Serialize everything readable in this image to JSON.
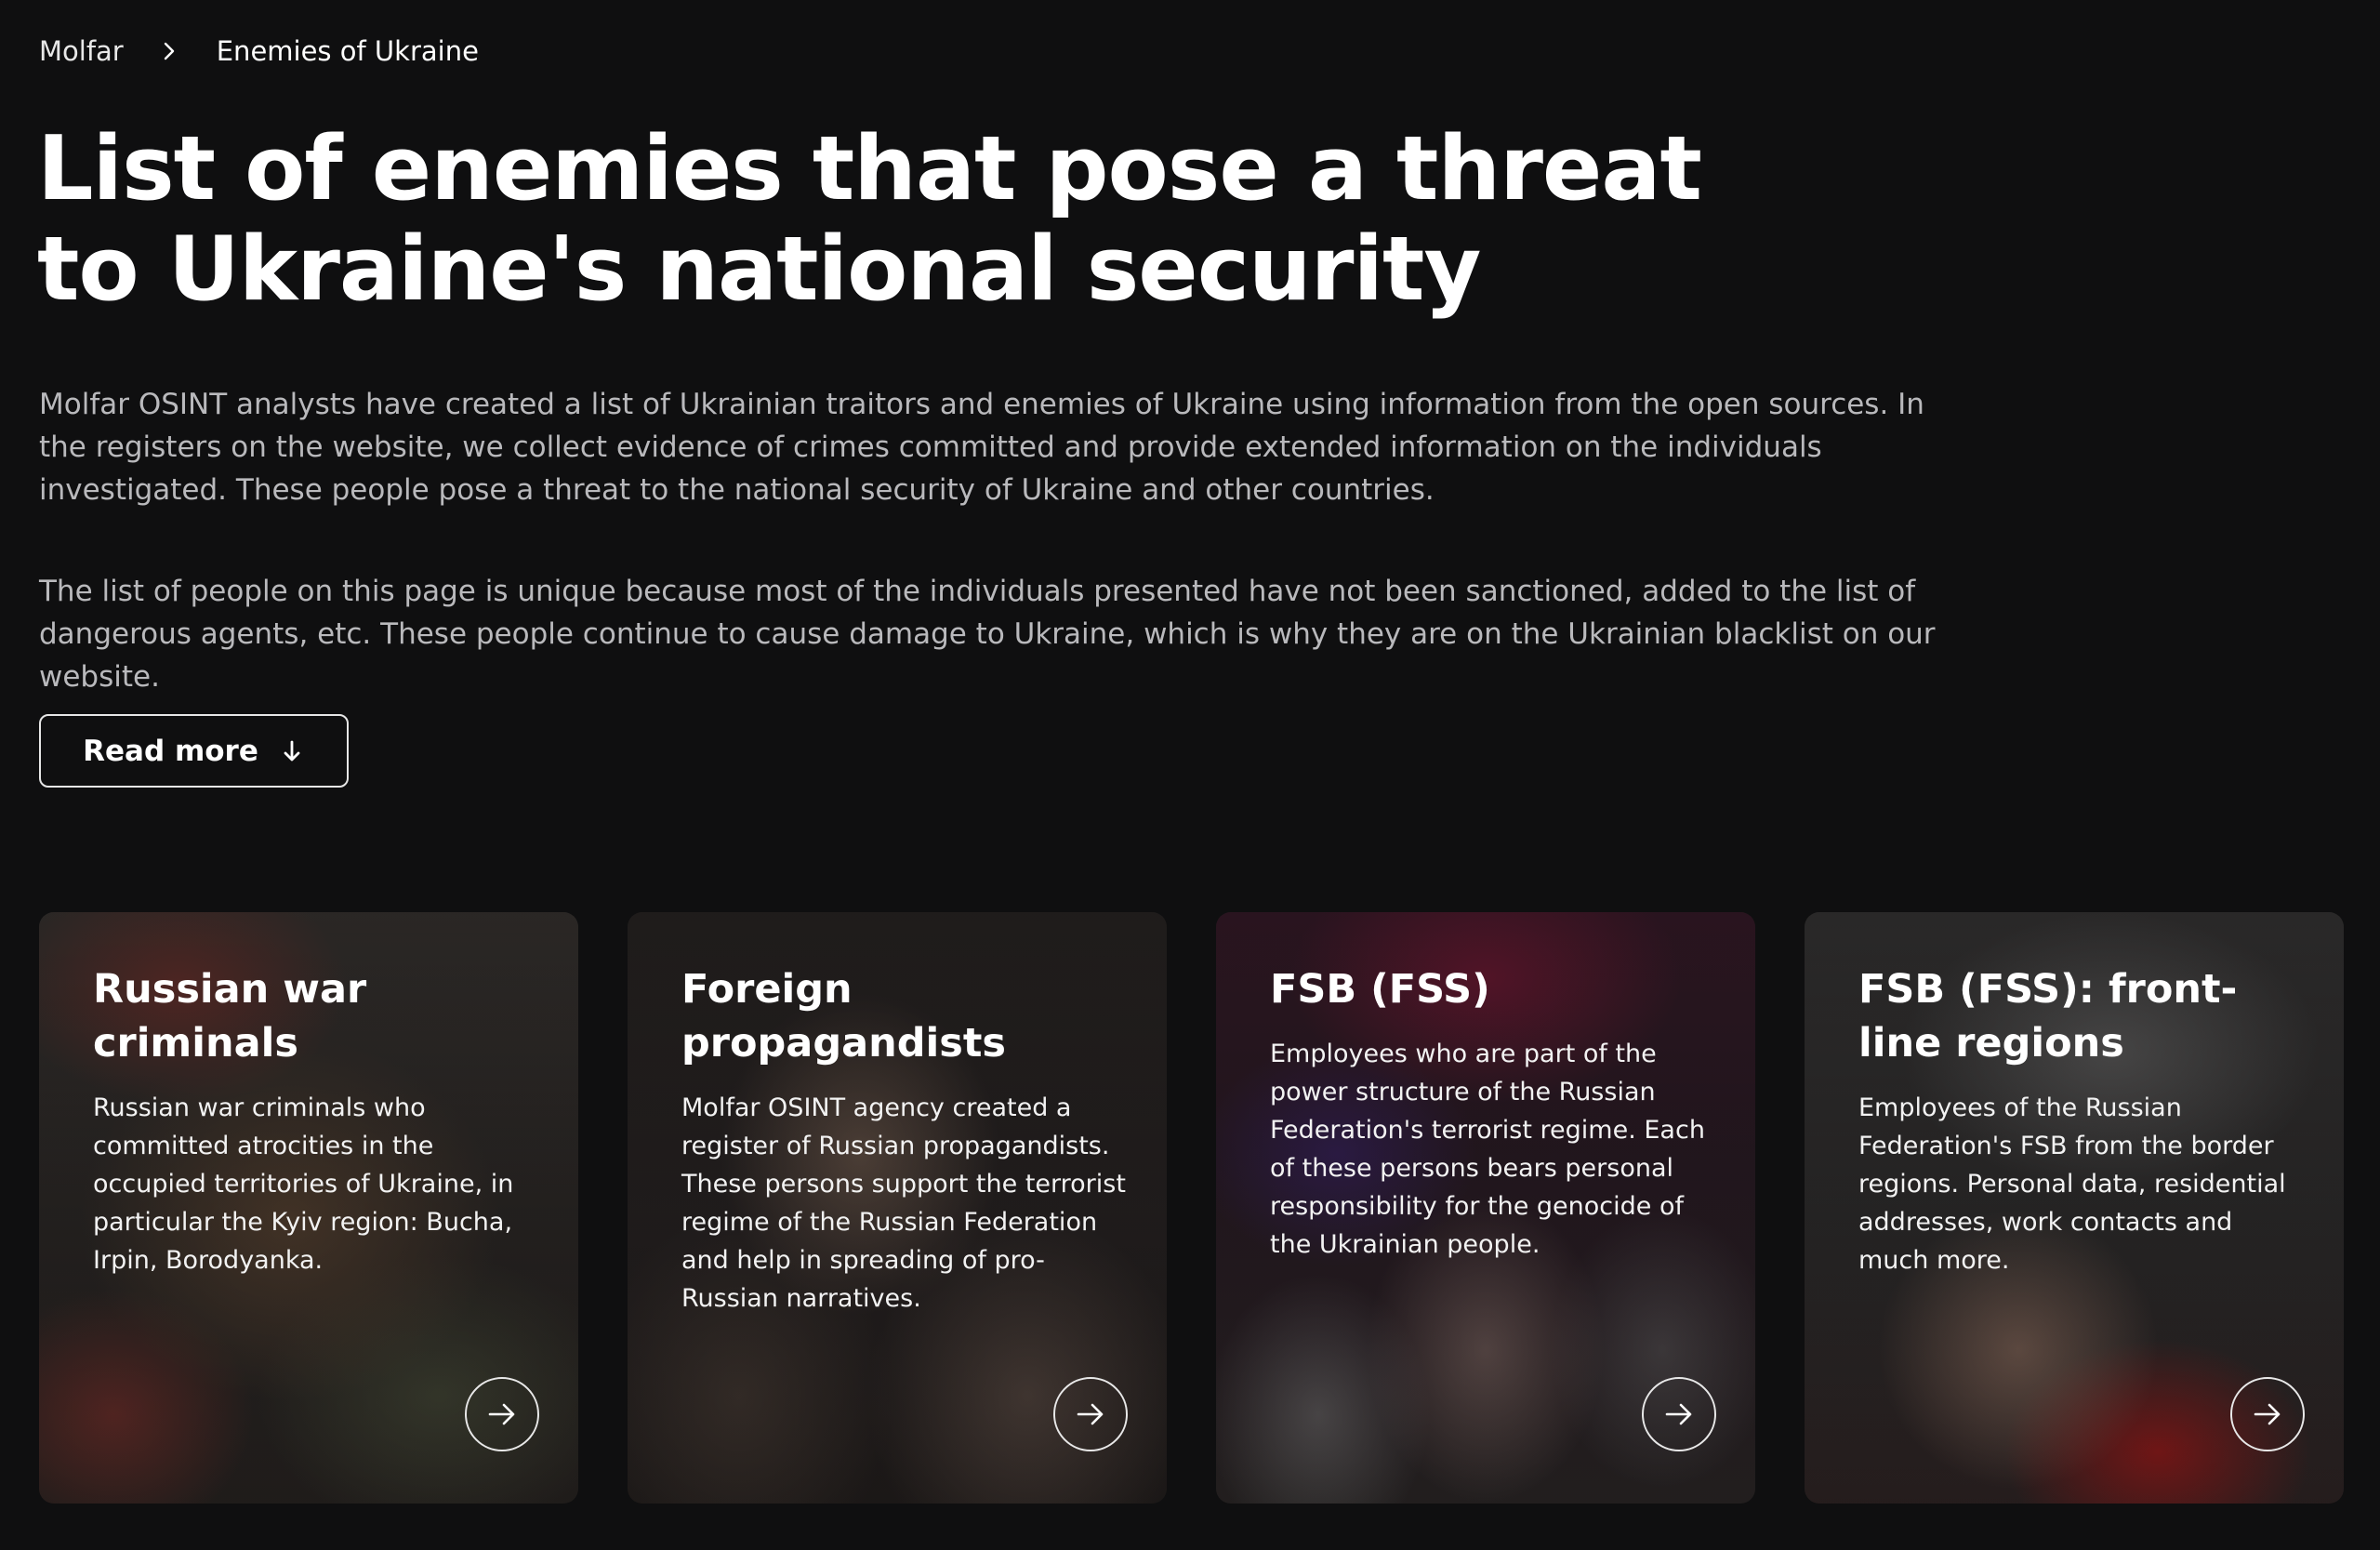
{
  "breadcrumb": {
    "home": "Molfar",
    "current": "Enemies of Ukraine"
  },
  "header": {
    "title": "List of enemies that pose a threat to Ukraine's national security"
  },
  "intro": {
    "paragraph_1": "Molfar OSINT analysts have created a list of Ukrainian traitors and enemies of Ukraine using information from the open sources. In the registers on the website, we collect evidence of crimes committed and provide extended information on the individuals investigated. These people pose a threat to the national security of Ukraine and other countries.",
    "paragraph_2": "The list of people on this page is unique because most of the individuals presented have not been sanctioned, added to the list of dangerous agents, etc. These people continue to cause damage to Ukraine, which is why they are on the Ukrainian blacklist on our website."
  },
  "read_more": {
    "label": "Read more",
    "icon": "arrow-down-icon"
  },
  "cards": [
    {
      "title": "Russian war criminals",
      "text": "Russian war criminals who committed atrocities in the occupied territories of Ukraine, in particular the Kyiv region: Bucha, Irpin, Borodyanka.",
      "icon": "arrow-right-icon"
    },
    {
      "title": "Foreign propagandists",
      "text": "Molfar OSINT agency created a register of Russian propagandists. These persons support the terrorist regime of the Russian Federation and help in spreading of pro-Russian narratives.",
      "icon": "arrow-right-icon"
    },
    {
      "title": "FSB (FSS)",
      "text": "Employees who are part of the power structure of the Russian Federation's terrorist regime. Each of these persons bears personal responsibility for the genocide of the Ukrainian people.",
      "icon": "arrow-right-icon"
    },
    {
      "title": "FSB (FSS): front-line regions",
      "text": "Employees of the Russian Federation's FSB from the border regions. Personal data, residential addresses, work contacts and much more.",
      "icon": "arrow-right-icon"
    }
  ],
  "colors": {
    "background": "#0f0f10",
    "text_primary": "#ffffff",
    "text_secondary": "#b9b9bc"
  }
}
